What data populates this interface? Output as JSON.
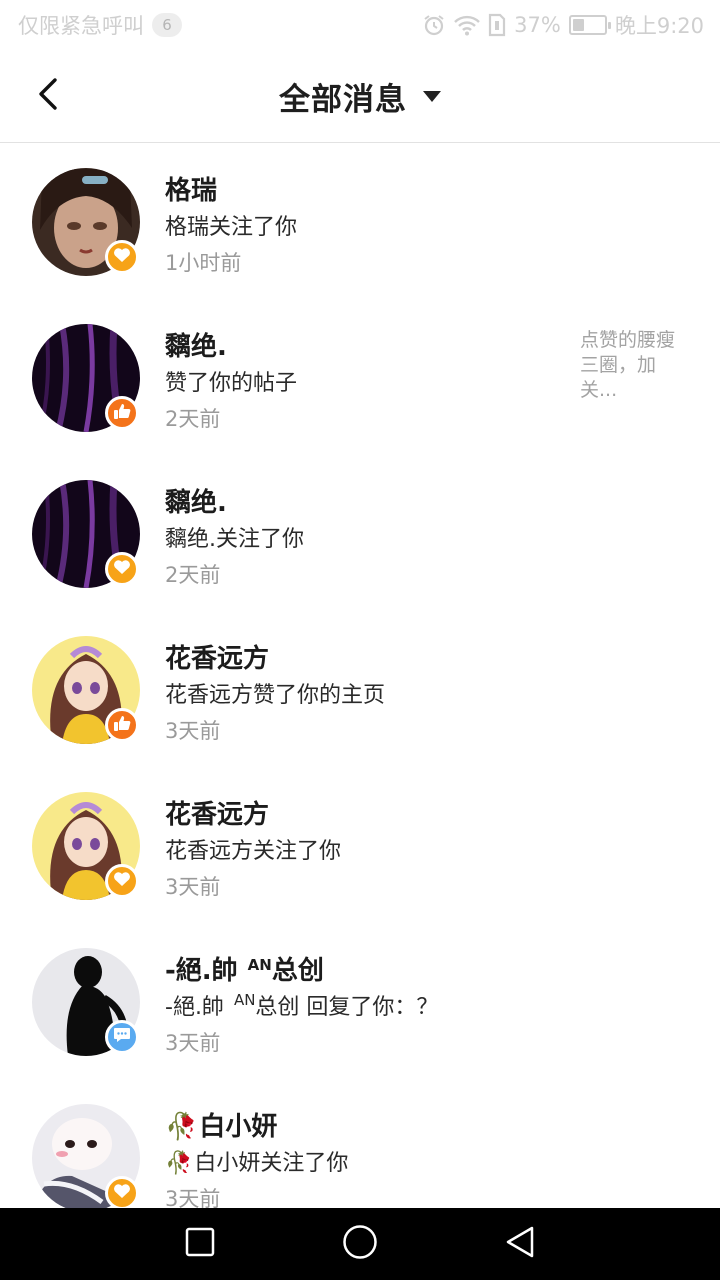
{
  "status_bar": {
    "carrier": "仅限紧急呼叫",
    "notification_count": "6",
    "battery": "37%",
    "battery_level": 0.37,
    "time": "晚上9:20",
    "icons": [
      "alarm-icon",
      "wifi-icon",
      "sim-icon",
      "battery-icon"
    ]
  },
  "header": {
    "title": "全部消息",
    "back_icon": "chevron-left-icon",
    "dropdown_icon": "caret-down-icon"
  },
  "messages": [
    {
      "name": "格瑞",
      "desc": "格瑞关注了你",
      "time": "1小时前",
      "type": "follow",
      "badge_icon": "heart-icon"
    },
    {
      "name": "黐绝.",
      "desc": "赞了你的帖子",
      "time": "2天前",
      "type": "like",
      "badge_icon": "thumbs-up-icon",
      "preview": "点赞的腰瘦三圈，加关..."
    },
    {
      "name": "黐绝.",
      "desc": "黐绝.关注了你",
      "time": "2天前",
      "type": "follow",
      "badge_icon": "heart-icon"
    },
    {
      "name": "花香远方",
      "desc": "花香远方赞了你的主页",
      "time": "3天前",
      "type": "like",
      "badge_icon": "thumbs-up-icon"
    },
    {
      "name": "花香远方",
      "desc": "花香远方关注了你",
      "time": "3天前",
      "type": "follow",
      "badge_icon": "heart-icon"
    },
    {
      "name": "-絕.帥",
      "name_sup": "AN",
      "name_suffix": "总创",
      "desc": "-絕.帥",
      "desc_sup": "AN",
      "desc_suffix": "总创 回复了你：？",
      "time": "3天前",
      "type": "reply",
      "badge_icon": "chat-bubble-icon"
    },
    {
      "name": "白小妍",
      "name_prefix": "🥀",
      "desc": "白小妍关注了你",
      "desc_prefix": "🥀",
      "time": "3天前",
      "type": "follow",
      "badge_icon": "heart-icon"
    }
  ],
  "nav": {
    "icons": [
      "recent-apps-icon",
      "home-icon",
      "back-icon"
    ]
  },
  "colors": {
    "follow_badge": "#f7a318",
    "like_badge": "#f4731a",
    "reply_badge": "#5aaaf0",
    "nav_bar": "#000000"
  }
}
